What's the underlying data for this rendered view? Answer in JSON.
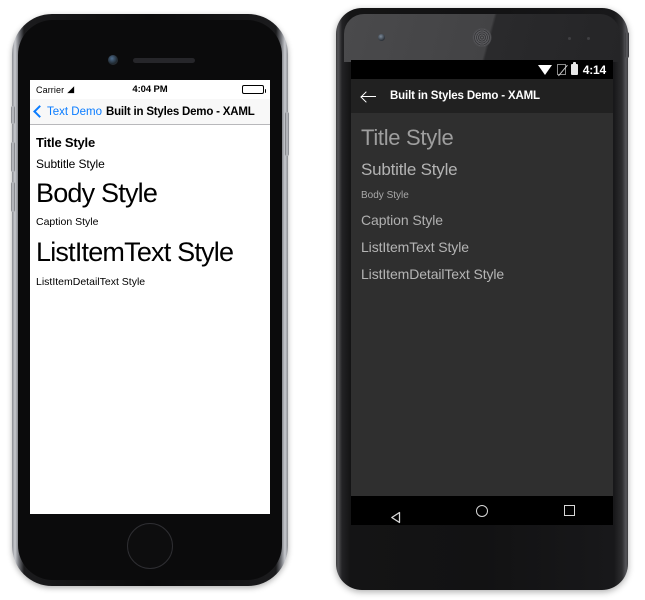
{
  "ios": {
    "status_bar": {
      "carrier": "Carrier",
      "wifi_icon": "wifi-icon",
      "clock": "4:04 PM",
      "battery_icon": "battery-full-icon"
    },
    "nav_bar": {
      "back_icon": "chevron-left-icon",
      "back_label": "Text Demo",
      "title": "Built in Styles Demo - XAML"
    },
    "styles": [
      {
        "label": "Title Style"
      },
      {
        "label": "Subtitle Style"
      },
      {
        "label": "Body Style"
      },
      {
        "label": "Caption Style"
      },
      {
        "label": "ListItemText Style"
      },
      {
        "label": "ListItemDetailText Style"
      }
    ],
    "colors": {
      "tint": "#0a7cff",
      "navbar_bg": "#f8f8f8",
      "screen_bg": "#ffffff",
      "text": "#000000"
    }
  },
  "android": {
    "status_bar": {
      "wifi_icon": "wifi-icon",
      "signal_icon": "no-sim-signal-icon",
      "battery_icon": "battery-icon",
      "clock": "4:14"
    },
    "action_bar": {
      "back_icon": "arrow-left-icon",
      "title": "Built in Styles Demo - XAML"
    },
    "styles": [
      {
        "label": "Title Style"
      },
      {
        "label": "Subtitle Style"
      },
      {
        "label": "Body Style"
      },
      {
        "label": "Caption Style"
      },
      {
        "label": "ListItemText Style"
      },
      {
        "label": "ListItemDetailText Style"
      }
    ],
    "nav_bar": {
      "back_icon": "triangle-back-icon",
      "home_icon": "circle-home-icon",
      "recents_icon": "square-recents-icon"
    },
    "colors": {
      "status_bg": "#000000",
      "actionbar_bg": "#212121",
      "screen_bg": "#2f2f2f",
      "text": "#b5b5b5"
    }
  }
}
